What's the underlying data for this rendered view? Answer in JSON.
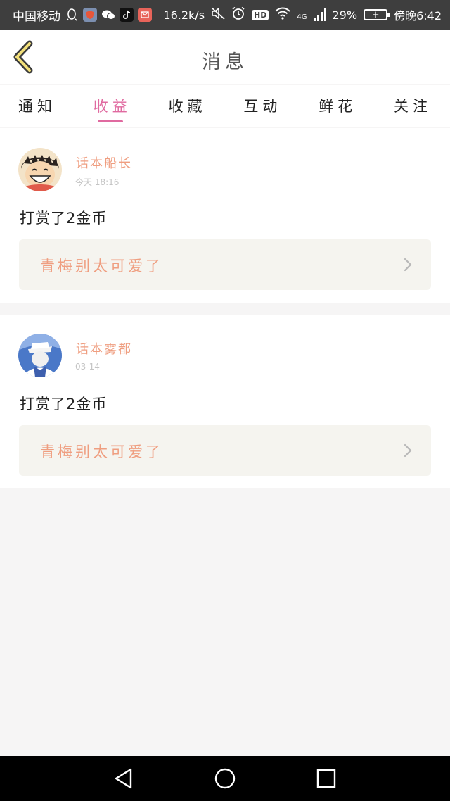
{
  "status_bar": {
    "carrier": "中国移动",
    "net_speed": "16.2k/s",
    "hd_badge": "HD",
    "network_type": "4G",
    "battery": "29%",
    "time": "傍晚6:42"
  },
  "header": {
    "title": "消息"
  },
  "tabs": [
    {
      "label": "通知",
      "active": false
    },
    {
      "label": "收益",
      "active": true
    },
    {
      "label": "收藏",
      "active": false
    },
    {
      "label": "互动",
      "active": false
    },
    {
      "label": "鲜花",
      "active": false
    },
    {
      "label": "关注",
      "active": false
    }
  ],
  "messages": [
    {
      "user": "话本船长",
      "time": "今天 18:16",
      "text": "打赏了2金币",
      "book_title": "青梅别太可爱了"
    },
    {
      "user": "话本雾都",
      "time": "03-14",
      "text": "打赏了2金币",
      "book_title": "青梅别太可爱了"
    }
  ],
  "colors": {
    "accent_pink": "#e06aa0",
    "name_orange": "#ef9e80",
    "back_yellow": "#f3e07a"
  }
}
